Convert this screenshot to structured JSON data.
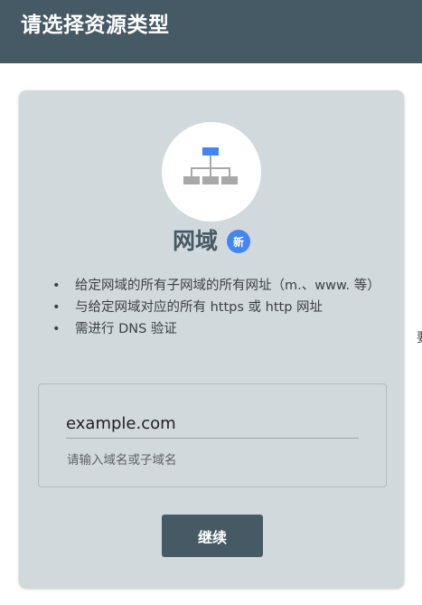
{
  "header": {
    "title": "请选择资源类型"
  },
  "card": {
    "icon": "sitemap-icon",
    "title": "网域",
    "badge": "新",
    "features": [
      "给定网域的所有子网域的所有网址（m.、www. 等）",
      "与给定网域对应的所有 https 或 http 网址",
      "需进行 DNS 验证"
    ],
    "domain_input": {
      "value": "example.com",
      "hint": "请输入域名或子域名"
    },
    "continue_label": "继续"
  },
  "edge_fragment": "要",
  "colors": {
    "header_bg": "#455a64",
    "card_bg": "#d2d9dd",
    "badge_bg": "#4285f4",
    "icon_accent": "#4285f4",
    "icon_gray": "#a8a8a8"
  }
}
